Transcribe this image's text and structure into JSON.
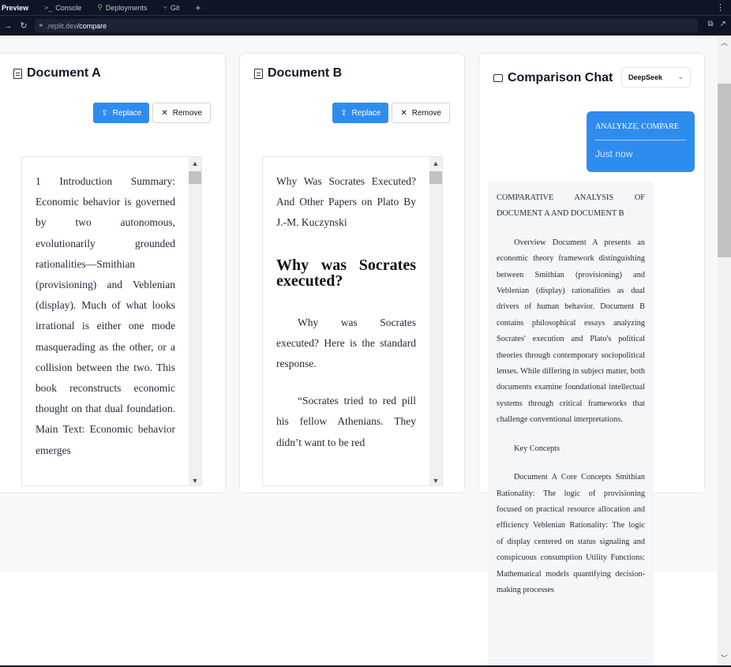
{
  "ide": {
    "tabs": [
      {
        "label": "Preview",
        "icon": ""
      },
      {
        "label": "Console",
        "icon": ">_"
      },
      {
        "label": "Deployments",
        "icon": "⚲"
      },
      {
        "label": "Git",
        "icon": "⑂"
      }
    ],
    "plus": "+",
    "kebab": "⋮",
    "url_domain": ".replit.dev",
    "url_path": "/compare"
  },
  "doc_a": {
    "title": "Document A",
    "replace_label": "Replace",
    "remove_label": "Remove",
    "paragraphs": [
      "1 Introduction Summary: Economic behavior is governed by two autonomous, evolutionarily grounded rationalities—Smithian (provisioning) and Veblenian (display). Much of what looks irrational is either one mode masquerading as the other, or a collision between the two. This book reconstructs economic thought on that dual foundation. Main Text: Economic behavior emerges"
    ]
  },
  "doc_b": {
    "title": "Document B",
    "replace_label": "Replace",
    "remove_label": "Remove",
    "intro": "Why Was Socrates Executed? And Other Papers on Plato By J.-M. Kuczynski",
    "heading": "Why was Socrates executed?",
    "para1": "Why was Socrates executed? Here is the standard response.",
    "para2": "“Socrates tried to red pill his fellow Athenians. They didn’t want to be red"
  },
  "chat": {
    "title": "Comparison Chat",
    "model": "DeepSeek",
    "user_message": "ANALYKZE, COMPARE",
    "user_time": "Just now",
    "ai_title": "COMPARATIVE ANALYSIS OF DOCUMENT A AND DOCUMENT B",
    "ai_overview": "Overview Document A presents an economic theory framework distinguishing between Smithian (provisioning) and Veblenian (display) rationalities as dual drivers of human behavior. Document B contains philosophical essays analyzing Socrates' execution and Plato's political theories through contemporary sociopolitical lenses. While differing in subject matter, both documents examine foundational intellectual systems through critical frameworks that challenge conventional interpretations.",
    "ai_key": "Key Concepts",
    "ai_concepts": "Document A Core Concepts Smithian Rationality: The logic of provisioning focused on practical resource allocation and efficiency Veblenian Rationality: The logic of display centered on status signaling and conspicuous consumption Utility Functions: Mathematical models quantifying decision-making processes"
  }
}
